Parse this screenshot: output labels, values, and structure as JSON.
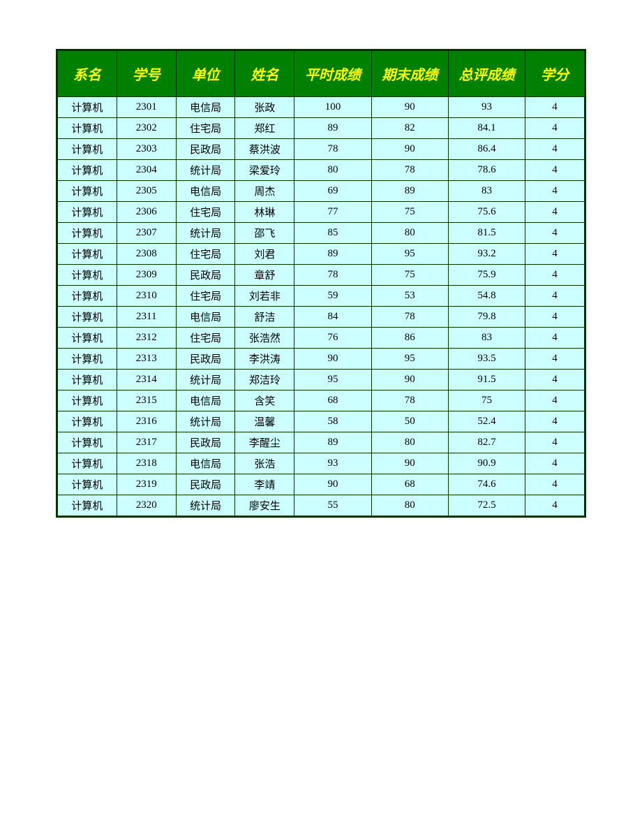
{
  "headers": {
    "dept": "系名",
    "id": "学号",
    "unit": "单位",
    "name": "姓名",
    "usual": "平时成绩",
    "final": "期末成绩",
    "total": "总评成绩",
    "credit": "学分"
  },
  "rows": [
    {
      "dept": "计算机",
      "id": "2301",
      "unit": "电信局",
      "name": "张政",
      "usual": "100",
      "final": "90",
      "total": "93",
      "credit": "4"
    },
    {
      "dept": "计算机",
      "id": "2302",
      "unit": "住宅局",
      "name": "郑红",
      "usual": "89",
      "final": "82",
      "total": "84.1",
      "credit": "4"
    },
    {
      "dept": "计算机",
      "id": "2303",
      "unit": "民政局",
      "name": "蔡洪波",
      "usual": "78",
      "final": "90",
      "total": "86.4",
      "credit": "4"
    },
    {
      "dept": "计算机",
      "id": "2304",
      "unit": "统计局",
      "name": "梁爱玲",
      "usual": "80",
      "final": "78",
      "total": "78.6",
      "credit": "4"
    },
    {
      "dept": "计算机",
      "id": "2305",
      "unit": "电信局",
      "name": "周杰",
      "usual": "69",
      "final": "89",
      "total": "83",
      "credit": "4"
    },
    {
      "dept": "计算机",
      "id": "2306",
      "unit": "住宅局",
      "name": "林琳",
      "usual": "77",
      "final": "75",
      "total": "75.6",
      "credit": "4"
    },
    {
      "dept": "计算机",
      "id": "2307",
      "unit": "统计局",
      "name": "邵飞",
      "usual": "85",
      "final": "80",
      "total": "81.5",
      "credit": "4"
    },
    {
      "dept": "计算机",
      "id": "2308",
      "unit": "住宅局",
      "name": "刘君",
      "usual": "89",
      "final": "95",
      "total": "93.2",
      "credit": "4"
    },
    {
      "dept": "计算机",
      "id": "2309",
      "unit": "民政局",
      "name": "章舒",
      "usual": "78",
      "final": "75",
      "total": "75.9",
      "credit": "4"
    },
    {
      "dept": "计算机",
      "id": "2310",
      "unit": "住宅局",
      "name": "刘若非",
      "usual": "59",
      "final": "53",
      "total": "54.8",
      "credit": "4"
    },
    {
      "dept": "计算机",
      "id": "2311",
      "unit": "电信局",
      "name": "舒洁",
      "usual": "84",
      "final": "78",
      "total": "79.8",
      "credit": "4"
    },
    {
      "dept": "计算机",
      "id": "2312",
      "unit": "住宅局",
      "name": "张浩然",
      "usual": "76",
      "final": "86",
      "total": "83",
      "credit": "4"
    },
    {
      "dept": "计算机",
      "id": "2313",
      "unit": "民政局",
      "name": "李洪涛",
      "usual": "90",
      "final": "95",
      "total": "93.5",
      "credit": "4"
    },
    {
      "dept": "计算机",
      "id": "2314",
      "unit": "统计局",
      "name": "郑洁玲",
      "usual": "95",
      "final": "90",
      "total": "91.5",
      "credit": "4"
    },
    {
      "dept": "计算机",
      "id": "2315",
      "unit": "电信局",
      "name": "含笑",
      "usual": "68",
      "final": "78",
      "total": "75",
      "credit": "4"
    },
    {
      "dept": "计算机",
      "id": "2316",
      "unit": "统计局",
      "name": "温馨",
      "usual": "58",
      "final": "50",
      "total": "52.4",
      "credit": "4"
    },
    {
      "dept": "计算机",
      "id": "2317",
      "unit": "民政局",
      "name": "李醒尘",
      "usual": "89",
      "final": "80",
      "total": "82.7",
      "credit": "4"
    },
    {
      "dept": "计算机",
      "id": "2318",
      "unit": "电信局",
      "name": "张浩",
      "usual": "93",
      "final": "90",
      "total": "90.9",
      "credit": "4"
    },
    {
      "dept": "计算机",
      "id": "2319",
      "unit": "民政局",
      "name": "李靖",
      "usual": "90",
      "final": "68",
      "total": "74.6",
      "credit": "4"
    },
    {
      "dept": "计算机",
      "id": "2320",
      "unit": "统计局",
      "name": "廖安生",
      "usual": "55",
      "final": "80",
      "total": "72.5",
      "credit": "4"
    }
  ],
  "watermark": ""
}
